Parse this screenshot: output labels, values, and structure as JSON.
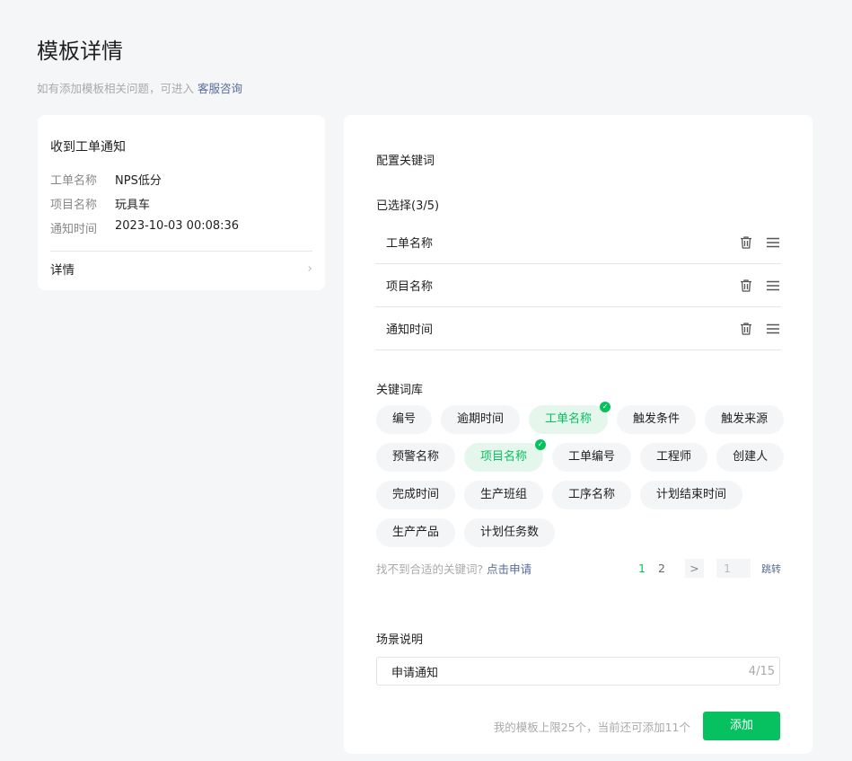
{
  "header": {
    "title": "模板详情",
    "hint": "如有添加模板相关问题，可进入",
    "hint_link": "客服咨询"
  },
  "preview": {
    "title": "收到工单通知",
    "fields": [
      {
        "k": "工单名称",
        "v": "NPS低分"
      },
      {
        "k": "项目名称",
        "v": "玩具车"
      },
      {
        "k": "通知时间",
        "v": "2023-10-03 00:08:36"
      }
    ],
    "detail": "详情"
  },
  "config": {
    "title": "配置关键词",
    "selected_label": "已选择(3/5)",
    "selected": [
      "工单名称",
      "项目名称",
      "通知时间"
    ],
    "library_label": "关键词库",
    "library": [
      {
        "t": "编号"
      },
      {
        "t": "逾期时间"
      },
      {
        "t": "工单名称",
        "on": true
      },
      {
        "t": "触发条件"
      },
      {
        "t": "触发来源"
      },
      {
        "t": "预警名称"
      },
      {
        "t": "项目名称",
        "on": true
      },
      {
        "t": "工单编号"
      },
      {
        "t": "工程师"
      },
      {
        "t": "创建人"
      },
      {
        "t": "完成时间"
      },
      {
        "t": "生产班组"
      },
      {
        "t": "工序名称"
      },
      {
        "t": "计划结束时间"
      },
      {
        "t": "生产产品"
      },
      {
        "t": "计划任务数"
      }
    ],
    "not_found": "找不到合适的关键词?",
    "apply": "点击申请",
    "pagination": {
      "pages": [
        "1",
        "2"
      ],
      "current": "1",
      "next": ">",
      "jump_value": "1",
      "jump": "跳转"
    },
    "scene_label": "场景说明",
    "scene_value": "申请通知",
    "scene_count": "4/15",
    "limit_text": "我的模板上限25个，当前还可添加11个",
    "add": "添加"
  },
  "colors": {
    "accent": "#07c160",
    "link": "#576b95"
  }
}
